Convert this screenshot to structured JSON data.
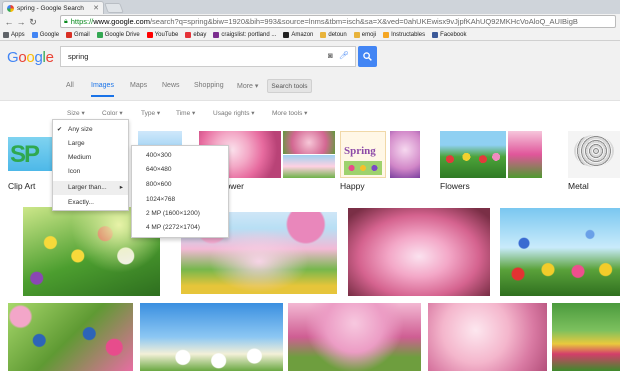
{
  "browser": {
    "tab_title": "spring - Google Search",
    "url_scheme": "https://",
    "url_host": "www.google.com",
    "url_rest": "/search?q=spring&biw=1920&bih=993&source=lnms&tbm=isch&sa=X&ved=0ahUKEwisx9vJjpfKAhUQ92MKHcVoAloQ_AUIBigB",
    "bookmarks": [
      {
        "label": "Apps",
        "icon": "apps-icon",
        "color": "#5f6368"
      },
      {
        "label": "Google",
        "icon": "google-icon",
        "color": "#4285f4"
      },
      {
        "label": "Gmail",
        "icon": "gmail-icon",
        "color": "#d93025"
      },
      {
        "label": "Google Drive",
        "icon": "drive-icon",
        "color": "#34a853"
      },
      {
        "label": "YouTube",
        "icon": "youtube-icon",
        "color": "#ff0000"
      },
      {
        "label": "ebay",
        "icon": "ebay-icon",
        "color": "#e53238"
      },
      {
        "label": "craigslist: portland ...",
        "icon": "peace-icon",
        "color": "#7b2d8e"
      },
      {
        "label": "Amazon",
        "icon": "amazon-icon",
        "color": "#222222"
      },
      {
        "label": "detoun",
        "icon": "folder-icon",
        "color": "#e8b33b"
      },
      {
        "label": "emoji",
        "icon": "folder-icon",
        "color": "#e8b33b"
      },
      {
        "label": "Instructables",
        "icon": "instructables-icon",
        "color": "#f5a623"
      },
      {
        "label": "Facebook",
        "icon": "facebook-icon",
        "color": "#3b5998"
      }
    ]
  },
  "google": {
    "logo": "Google",
    "query": "spring",
    "tabs": [
      "All",
      "Images",
      "Maps",
      "News",
      "Shopping",
      "More ▾"
    ],
    "active_tab": "Images",
    "search_tools": "Search tools",
    "filters": [
      "Size ▾",
      "Color ▾",
      "Type ▾",
      "Time ▾",
      "Usage rights ▾",
      "More tools ▾"
    ]
  },
  "size_menu": {
    "items": [
      "Any size",
      "Large",
      "Medium",
      "Icon",
      "Larger than...",
      "Exactly..."
    ],
    "selected": "Any size",
    "submenu_arrow": "▸"
  },
  "larger_than_menu": {
    "items": [
      "400×300",
      "640×480",
      "800×600",
      "1024×768",
      "2 MP (1600×1200)",
      "4 MP (2272×1704)"
    ]
  },
  "categories": [
    {
      "label": "Clip Art",
      "thumb_text": "SP"
    },
    {
      "label": "Flower"
    },
    {
      "label": "Happy",
      "thumb_text": "Spring"
    },
    {
      "label": "Flowers"
    },
    {
      "label": "Metal"
    }
  ],
  "colors": {
    "accent": "#1a73e8",
    "search_button": "#4285f4"
  }
}
